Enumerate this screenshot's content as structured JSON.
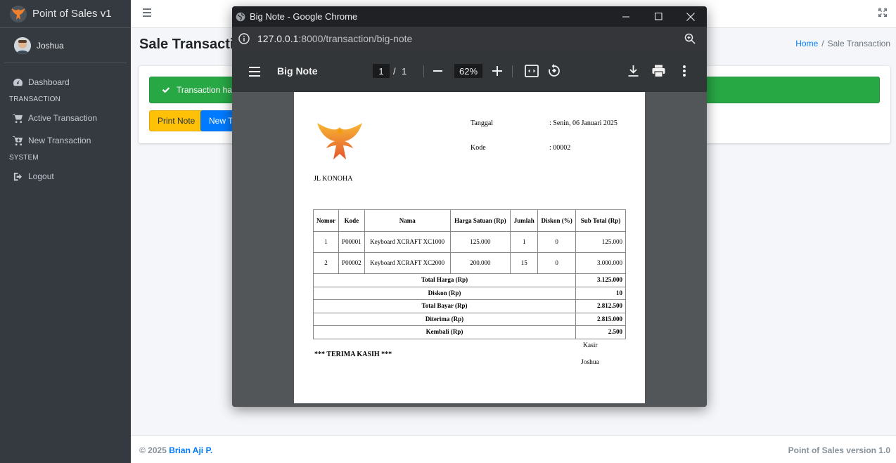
{
  "app": {
    "brand": "Point of Sales v1"
  },
  "user": {
    "name": "Joshua"
  },
  "sidebar": {
    "dashboard": "Dashboard",
    "header_transaction": "TRANSACTION",
    "active_transaction": "Active Transaction",
    "new_transaction": "New Transaction",
    "header_system": "SYSTEM",
    "logout": "Logout"
  },
  "page": {
    "title": "Sale Transaction",
    "breadcrumb_home": "Home",
    "breadcrumb_sep": "/",
    "breadcrumb_current": "Sale Transaction"
  },
  "alert": {
    "text": "Transaction has"
  },
  "buttons": {
    "print_note": "Print Note",
    "new_transaction": "New Tr"
  },
  "footer": {
    "copyright": "© 2025",
    "author": "Brian Aji P.",
    "version": "Point of Sales version 1.0"
  },
  "chrome": {
    "window_title": "Big Note - Google Chrome",
    "url_host": "127.0.0.1",
    "url_rest": ":8000/transaction/big-note"
  },
  "pdf": {
    "title": "Big Note",
    "page_current": "1",
    "page_sep": "/",
    "page_total": "1",
    "zoom": "62%"
  },
  "note": {
    "tanggal_label": "Tanggal",
    "tanggal_value": ": Senin, 06 Januari 2025",
    "kode_label": "Kode",
    "kode_value": ": 00002",
    "address": "JL KONOHA",
    "columns": [
      "Nomor",
      "Kode",
      "Nama",
      "Harga Satuan (Rp)",
      "Jumlah",
      "Diskon (%)",
      "Sub Total (Rp)"
    ],
    "rows": [
      {
        "no": "1",
        "kode": "P00001",
        "nama": "Keyboard XCRAFT XC1000",
        "harga": "125.000",
        "jumlah": "1",
        "diskon": "0",
        "subtotal": "125.000"
      },
      {
        "no": "2",
        "kode": "P00002",
        "nama": "Keyboard XCRAFT XC2000",
        "harga": "200.000",
        "jumlah": "15",
        "diskon": "0",
        "subtotal": "3.000.000"
      }
    ],
    "totals": [
      {
        "label": "Total Harga (Rp)",
        "value": "3.125.000"
      },
      {
        "label": "Diskon (Rp)",
        "value": "10"
      },
      {
        "label": "Total Bayar (Rp)",
        "value": "2.812.500"
      },
      {
        "label": "Diterima (Rp)",
        "value": "2.815.000"
      },
      {
        "label": "Kembali (Rp)",
        "value": "2.500"
      }
    ],
    "thanks": "*** TERIMA KASIH ***",
    "kasir_label": "Kasir",
    "kasir_name": "Joshua"
  },
  "colors": {
    "sidebar_bg": "#343a40",
    "success": "#28a745",
    "warning": "#ffc107",
    "primary": "#007bff"
  }
}
